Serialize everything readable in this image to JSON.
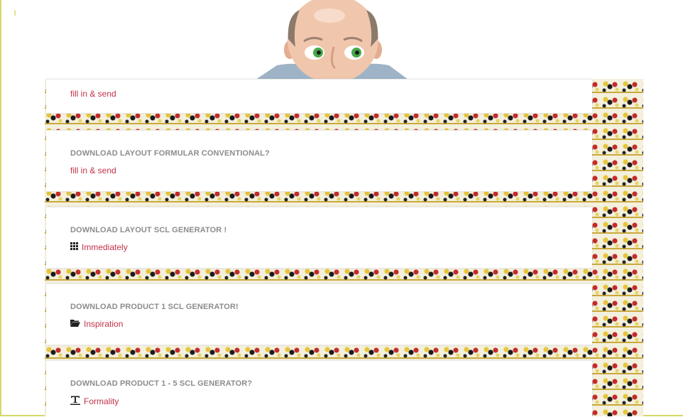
{
  "cards": [
    {
      "title": "",
      "link_label": "fill in & send",
      "link_icon": ""
    },
    {
      "title": "DOWNLOAD LAYOUT FORMULAR CONVENTIONAL?",
      "link_label": "fill in & send",
      "link_icon": ""
    },
    {
      "title": "DOWNLOAD LAYOUT SCL GENERATOR !",
      "link_label": "Immediately",
      "link_icon": "grid-icon"
    },
    {
      "title": "DOWNLOAD PRODUCT 1 SCL GENERATOR!",
      "link_label": "Inspiration",
      "link_icon": "folder-open-icon"
    },
    {
      "title": "DOWNLOAD PRODUCT 1 - 5 SCL GENERATOR?",
      "link_label": "Formality",
      "link_icon": "text-format-icon"
    }
  ],
  "colors": {
    "link": "#c2324a",
    "title": "#8c8c8c",
    "frame_border": "#d6d86a"
  }
}
